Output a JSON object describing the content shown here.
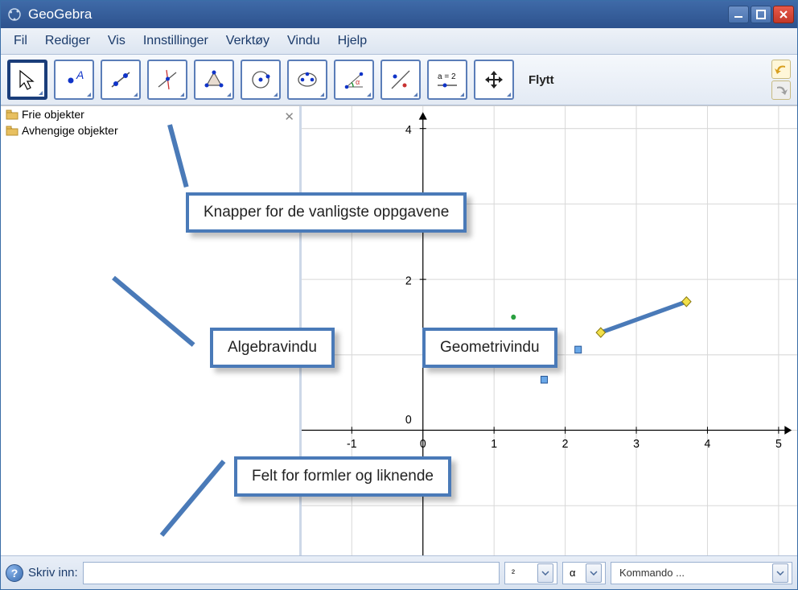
{
  "app": {
    "title": "GeoGebra"
  },
  "menu": {
    "file": "Fil",
    "edit": "Rediger",
    "view": "Vis",
    "options": "Innstillinger",
    "tools": "Verktøy",
    "window": "Vindu",
    "help": "Hjelp"
  },
  "toolbar": {
    "active_label": "Flytt",
    "tool_move": "move",
    "tool_point": "point",
    "tool_line": "line",
    "tool_perp": "perpendicular",
    "tool_polygon": "polygon",
    "tool_circle": "circle",
    "tool_ellipse": "ellipse",
    "tool_angle": "angle",
    "tool_reflect": "reflect",
    "tool_text": "a = 2",
    "tool_move_graphics": "move-graphics"
  },
  "algebra": {
    "free": "Frie objekter",
    "dependent": "Avhengige objekter"
  },
  "callouts": {
    "top": "Knapper for de vanligste oppgavene",
    "left": "Algebravindu",
    "right": "Geometrivindu",
    "bottom": "Felt for formler og liknende"
  },
  "chart_data": {
    "type": "line",
    "title": "",
    "xlabel": "",
    "ylabel": "",
    "xlim": [
      -1.5,
      5.5
    ],
    "ylim": [
      -0.5,
      5
    ],
    "x_ticks": [
      -1,
      0,
      1,
      2,
      3,
      4,
      5
    ],
    "y_ticks": [
      0,
      2,
      4
    ],
    "series": [
      {
        "name": "segment",
        "x": [
          2.5,
          3.7
        ],
        "y": [
          1.3,
          1.7
        ]
      }
    ]
  },
  "inputbar": {
    "label": "Skriv inn:",
    "value": "",
    "exp_symbol": "²",
    "alpha_symbol": "α",
    "command_label": "Kommando ...",
    "placeholder": ""
  }
}
